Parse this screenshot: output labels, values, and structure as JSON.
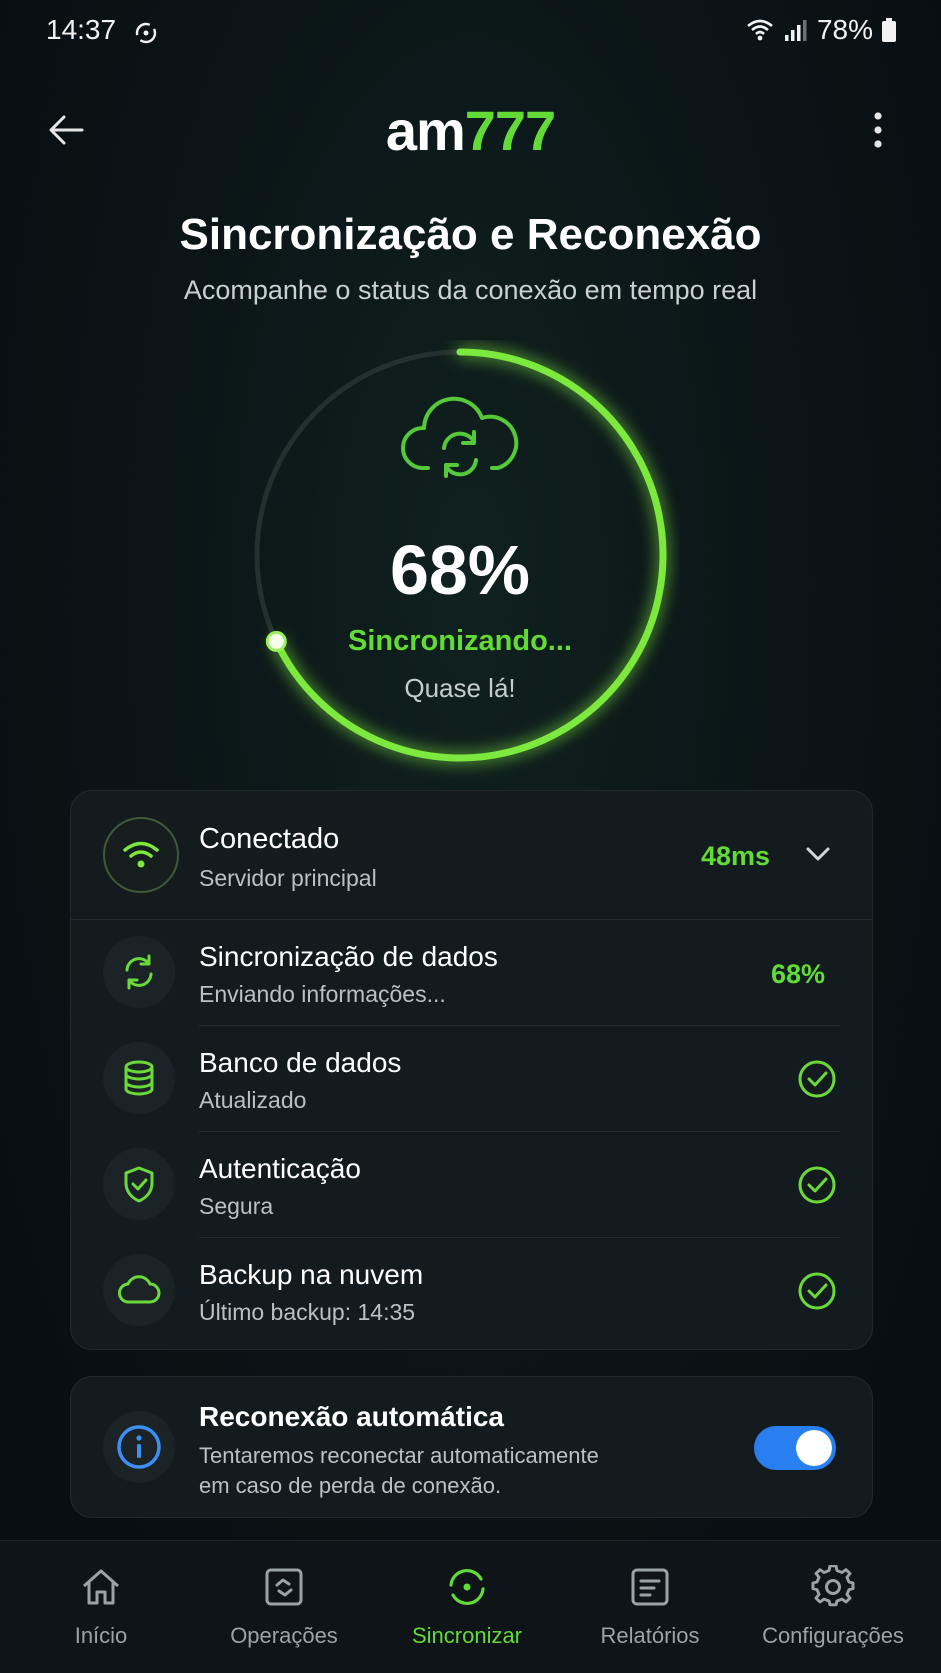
{
  "status_bar": {
    "time": "14:37",
    "battery": "78%"
  },
  "header": {
    "logo_white": "am",
    "logo_green": "777"
  },
  "page": {
    "title": "Sincronização e Reconexão",
    "subtitle": "Acompanhe o status da conexão em tempo real"
  },
  "progress": {
    "value": 0.68,
    "percent_label": "68%",
    "status": "Sincronizando...",
    "note": "Quase lá!"
  },
  "connection": {
    "title": "Conectado",
    "subtitle": "Servidor principal",
    "latency": "48ms"
  },
  "items": [
    {
      "title": "Sincronização de dados",
      "subtitle": "Enviando informações...",
      "value": "68%"
    },
    {
      "title": "Banco de dados",
      "subtitle": "Atualizado"
    },
    {
      "title": "Autenticação",
      "subtitle": "Segura"
    },
    {
      "title": "Backup na nuvem",
      "subtitle": "Último backup: 14:35"
    }
  ],
  "auto_reconnect": {
    "title": "Reconexão automática",
    "line1": "Tentaremos reconectar automaticamente",
    "line2": "em caso de perda de conexão.",
    "enabled": true
  },
  "nav": [
    {
      "label": "Início",
      "icon": "home-icon"
    },
    {
      "label": "Operações",
      "icon": "operations-icon"
    },
    {
      "label": "Sincronizar",
      "icon": "sync-icon",
      "active": true
    },
    {
      "label": "Relatórios",
      "icon": "reports-icon"
    },
    {
      "label": "Configurações",
      "icon": "settings-icon"
    }
  ],
  "colors": {
    "accent_green": "#63db37",
    "toggle_blue": "#2a7ff0",
    "background": "#0b1517"
  }
}
